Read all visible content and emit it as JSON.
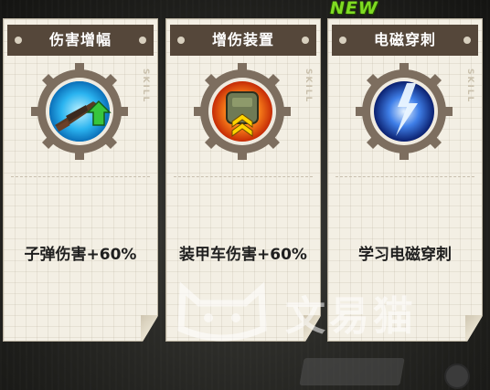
{
  "badge": "NEW",
  "cards": [
    {
      "title": "伤害增幅",
      "description": "子弹伤害+60%",
      "icon": "rifle-upgrade-icon",
      "skill_tag": "SKILL"
    },
    {
      "title": "增伤装置",
      "description": "装甲车伤害+60%",
      "icon": "armored-backpack-icon",
      "skill_tag": "SKILL"
    },
    {
      "title": "电磁穿刺",
      "description": "学习电磁穿刺",
      "icon": "electric-pierce-icon",
      "skill_tag": "SKILL"
    }
  ],
  "watermark": "文易猫",
  "colors": {
    "card_bg": "#f3efe4",
    "header_bg": "#55473a",
    "gear": "#7a6b5c",
    "new_badge": "#7fdb22"
  }
}
